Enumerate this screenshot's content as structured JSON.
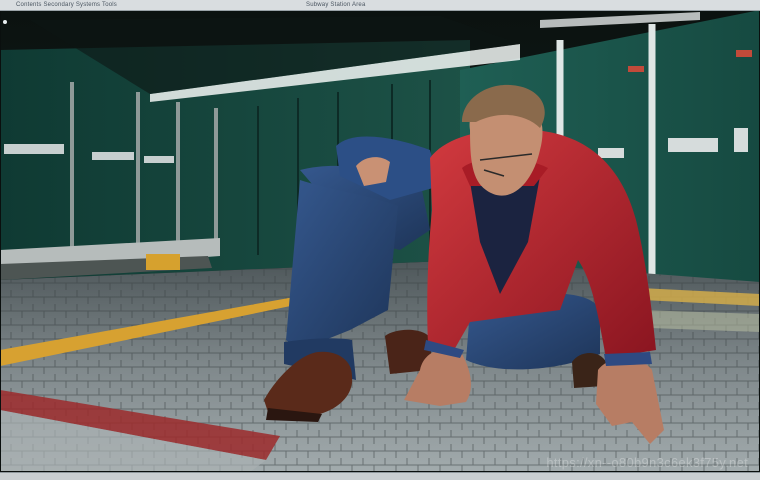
{
  "window": {
    "title_left": "Contents  Secondary Systems  Tools",
    "title_center": "Subway Station Area"
  },
  "watermark": "https://xn--o80b9n3c6ek3f75y.net",
  "colors": {
    "wall_green": "#1f5a4f",
    "jacket_red": "#b3202b",
    "trousers_blue": "#2a4a7a",
    "caution_yellow": "#e0a92a",
    "floor_stone": "#8e979a"
  }
}
